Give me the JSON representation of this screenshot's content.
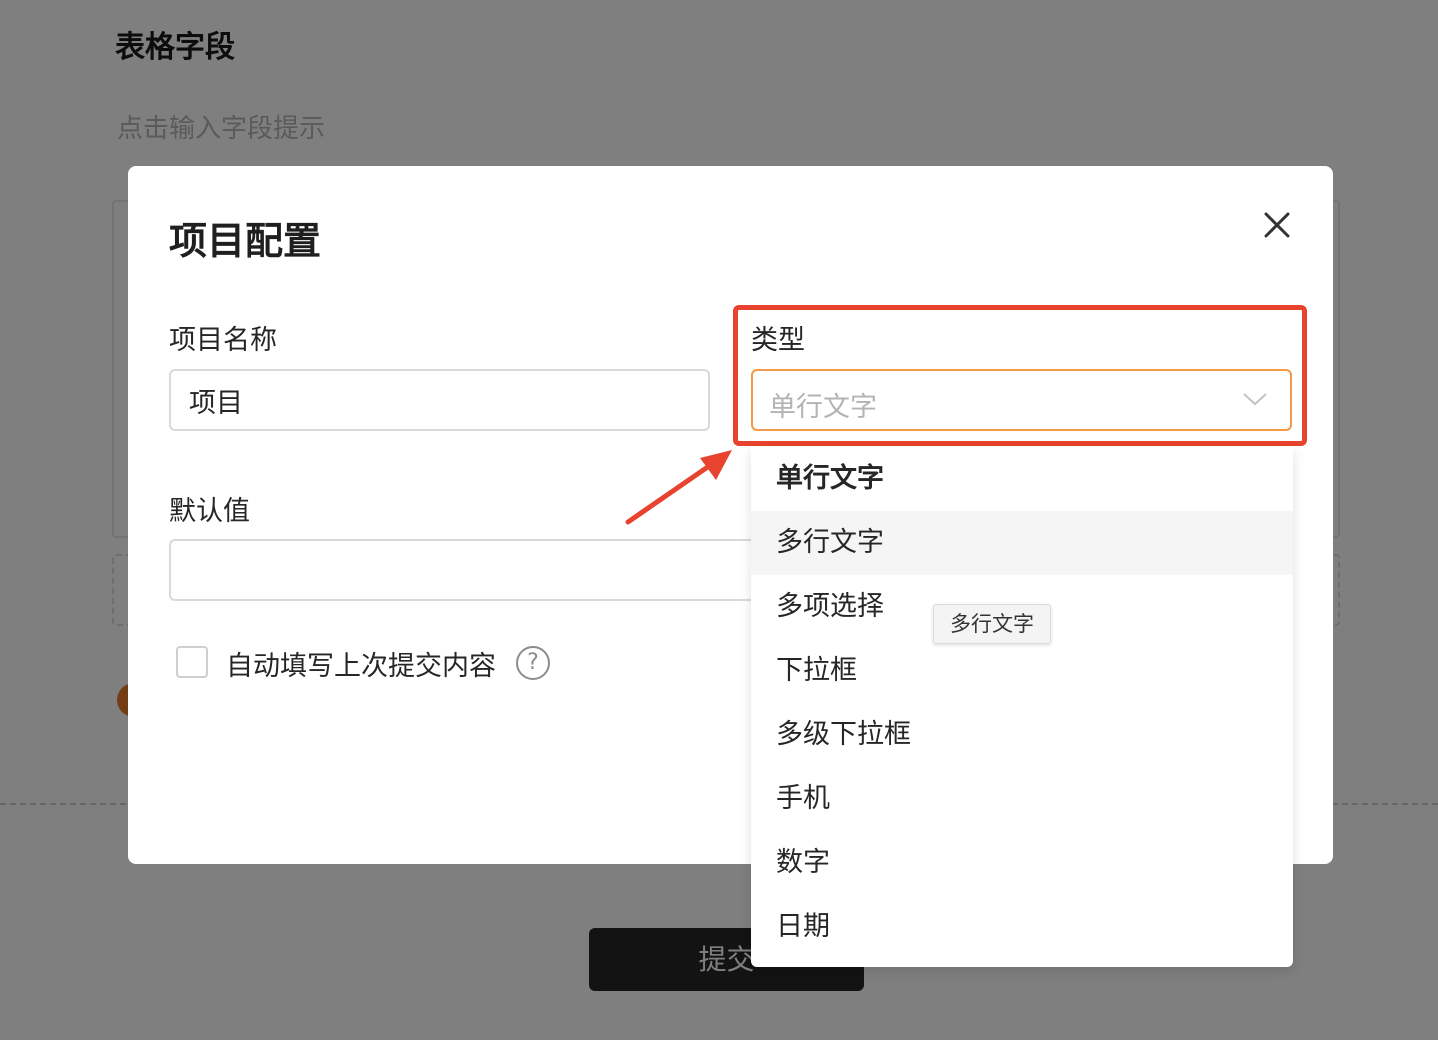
{
  "background": {
    "page_title": "表格字段",
    "field_hint": "点击输入字段提示",
    "submit_label": "提交"
  },
  "modal": {
    "title": "项目配置",
    "name_field": {
      "label": "项目名称",
      "value": "项目"
    },
    "type_field": {
      "label": "类型",
      "selected_value": "单行文字"
    },
    "default_field": {
      "label": "默认值",
      "value": ""
    },
    "autofill": {
      "label": "自动填写上次提交内容",
      "checked": false
    }
  },
  "dropdown": {
    "options": [
      {
        "label": "单行文字",
        "state": "selected"
      },
      {
        "label": "多行文字",
        "state": "hovered"
      },
      {
        "label": "多项选择",
        "state": "normal"
      },
      {
        "label": "下拉框",
        "state": "normal"
      },
      {
        "label": "多级下拉框",
        "state": "normal"
      },
      {
        "label": "手机",
        "state": "normal"
      },
      {
        "label": "数字",
        "state": "normal"
      },
      {
        "label": "日期",
        "state": "normal"
      }
    ],
    "tooltip": "多行文字"
  },
  "colors": {
    "accent_focus_border": "#f2994a",
    "annotation_red": "#e8432e",
    "overlay": "rgba(0,0,0,0.5)",
    "submit_bg": "#262626"
  },
  "icons": {
    "close": "close-icon",
    "dropdown_arrow": "chevron-down-icon",
    "help": "question-circle-icon"
  }
}
